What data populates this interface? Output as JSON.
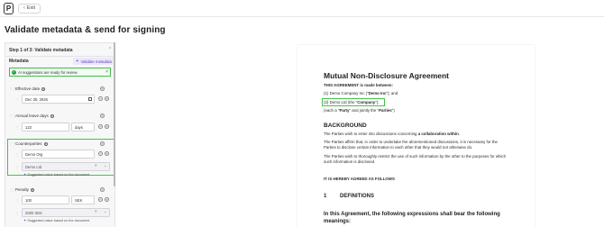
{
  "topbar": {
    "logo_letter": "P",
    "exit_label": "Exit",
    "exit_arrow": "‹"
  },
  "page_title": "Validate metadata & send for signing",
  "panel": {
    "step_title": "Step 1 of 3: Validate metadata",
    "step_chevron": "⌃",
    "metadata_label": "Metadata",
    "validate_button": "Validate metadata",
    "validate_icon": "sparkle-icon",
    "alert_text": "AI suggestions are ready for review",
    "effective_date": {
      "label": "Effective date",
      "value": "Dec 30, 2026"
    },
    "annual_leave": {
      "label": "Annual leave days",
      "value": "123",
      "unit": "days"
    },
    "counterparties": {
      "label": "Counterparties",
      "value": "Demo Org",
      "secondary_value": "Demo Ltd",
      "hint": "Suggested value based on the document"
    },
    "penalty": {
      "label": "Penalty",
      "amount": "100",
      "currency": "SEK",
      "secondary_value": "2000 SEK",
      "hint": "Suggested value based on the document"
    },
    "accent_color": "#45c34b",
    "highlight_purple": "#5a3fc0"
  },
  "document": {
    "title": "Mutual Non-Disclosure Agreement",
    "intro": "THIS AGREEMENT is made between:",
    "party1_prefix": "(1) Demo Company Inc (\"",
    "party1_bold": "Demo Inc",
    "party1_suffix": "\"); and",
    "party2_prefix": "(2) Demo Ltd (the \"",
    "party2_bold": "Company",
    "party2_suffix": "\");",
    "party_line_prefix": "(each a \"",
    "party_line_bold1": "Party",
    "party_line_mid": "\" and jointly the \"",
    "party_line_bold2": "Parties",
    "party_line_suffix": "\")",
    "background_heading": "BACKGROUND",
    "bg1_prefix": "The Parties wish to enter into discussions concerning ",
    "bg1_bold": "a collaboration within",
    "bg1_suffix": ".",
    "bg2": "The Parties affirm that, in order to undertake the aforementioned discussions, it is necessary for the Parties to disclose certain information to each other that they would not otherwise do.",
    "bg3": "The Parties wish to thoroughly restrict the use of such information by the other to the purposes for which such information is disclosed.",
    "agreed": "IT IS HEREBY AGREED AS FOLLOWS",
    "section_number": "1",
    "section_title": "DEFINITIONS",
    "definitions_intro": "In this Agreement, the following expressions shall bear the following meanings:"
  }
}
